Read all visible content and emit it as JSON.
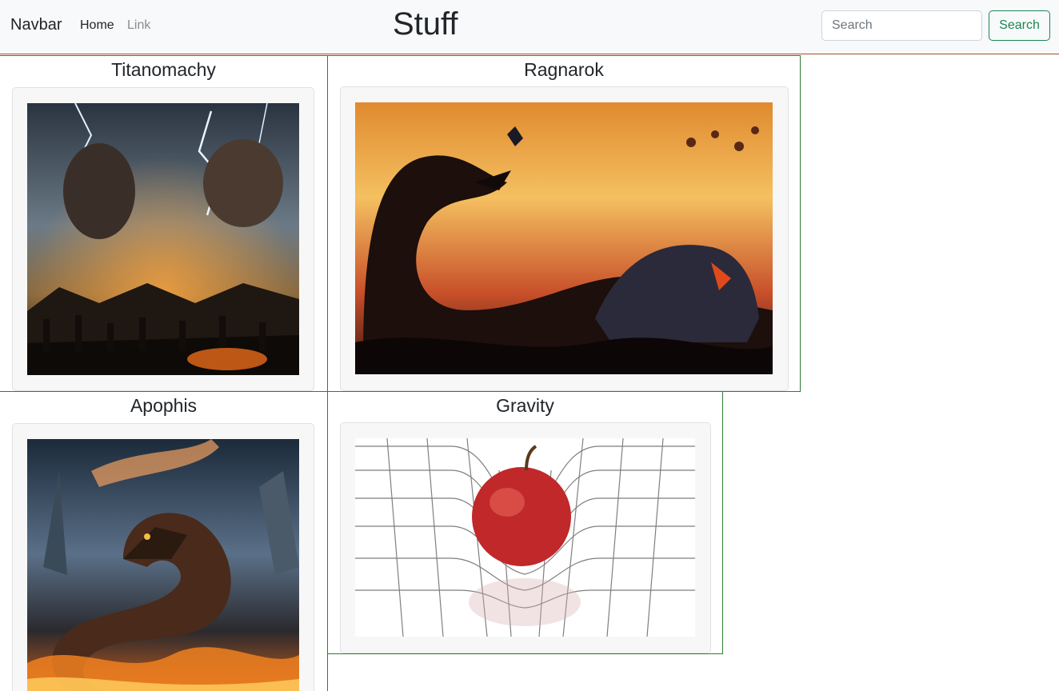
{
  "navbar": {
    "brand": "Navbar",
    "home": "Home",
    "link": "Link",
    "title": "Stuff",
    "search_placeholder": "Search",
    "search_button": "Search"
  },
  "cards": [
    {
      "title": "Titanomachy",
      "image_alt": "Titans battling gods amid lightning storm"
    },
    {
      "title": "Ragnarok",
      "image_alt": "Serpent and wolf battling warriors in fiery sky"
    },
    {
      "title": "Apophis",
      "image_alt": "Giant serpent coiled in flames under stormy sky"
    },
    {
      "title": "Gravity",
      "image_alt": "Apple resting on warped spacetime grid"
    }
  ],
  "colors": {
    "accent": "#198754",
    "card_border": "#2e7d32",
    "navbar_bg": "#f8f9fa"
  }
}
